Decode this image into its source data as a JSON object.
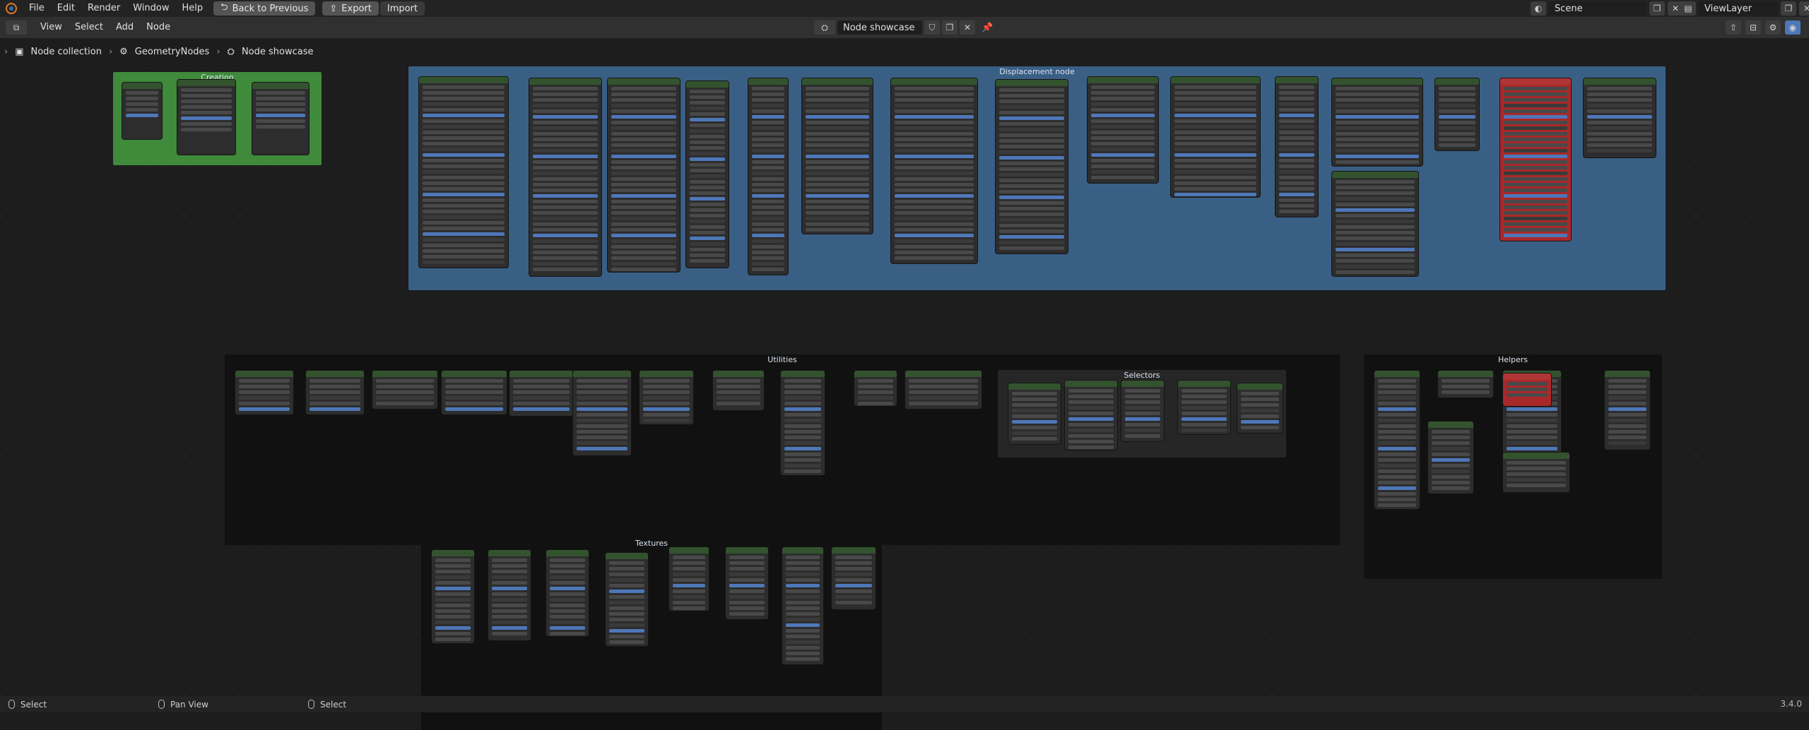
{
  "menu": {
    "items": [
      "File",
      "Edit",
      "Render",
      "Window",
      "Help"
    ],
    "back_label": "Back to Previous",
    "export_label": "Export",
    "import_label": "Import",
    "scene_label": "Scene",
    "view_layer_label": "ViewLayer"
  },
  "editor_header": {
    "menus": [
      "View",
      "Select",
      "Add",
      "Node"
    ],
    "node_tree_name": "Node showcase"
  },
  "breadcrumb": [
    "Node collection",
    "GeometryNodes",
    "Node showcase"
  ],
  "frames": {
    "creation": "Creation",
    "displacement": "Displacement node",
    "utilities": "Utilities",
    "selectors": "Selectors",
    "helpers": "Helpers",
    "textures": "Textures"
  },
  "status": {
    "left_action": "Select",
    "middle_action": "Pan View",
    "right_action": "Select",
    "version": "3.4.0"
  },
  "colors": {
    "accent_blue": "#4e77b8",
    "frame_green": "#3f8a3b",
    "frame_blue": "#3a5f85",
    "frame_dark": "#111111",
    "node_header_green": "#33532e",
    "node_red": "#a9282a"
  },
  "icons": [
    "blender-logo-icon",
    "back-arrow-icon",
    "export-icon",
    "import-icon",
    "editor-type-icon",
    "node-tree-icon",
    "shield-icon",
    "duplicate-icon",
    "close-icon",
    "pin-icon",
    "scene-icon",
    "view-layer-icon",
    "mouse-left-icon",
    "mouse-middle-icon",
    "mouse-right-icon"
  ]
}
